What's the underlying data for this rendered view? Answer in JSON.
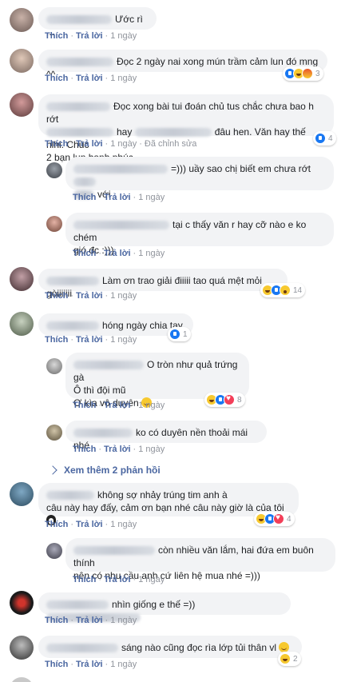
{
  "meta": {
    "like": "Thích",
    "reply": "Trả lời",
    "time": "1 ngày",
    "edited": "Đã chỉnh sửa",
    "dot": "·"
  },
  "comments": [
    {
      "text": "Ước rì ..."
    },
    {
      "text": "Đọc 2 ngày nai xong mún trầm cảm lun đó mng ^^",
      "count": "3"
    },
    {
      "line1": "Đọc xong bài tui đoán chủ tus chắc chưa bao h rớt",
      "line2a": "hay",
      "line2b": "đâu hen. Văn hay thế hihi. Chúc",
      "line3": "2 bạn lun hạnh phúc",
      "count": "4"
    },
    {
      "line1": "=))) uầy sao chị biết em chưa rớt",
      "line2": "với"
    },
    {
      "line1": "tại c thấy văn r hay cỡ nào e ko chém",
      "line2": "gió đc :)))"
    },
    {
      "text": "Làm ơn trao giải điiiii tao quá mệt mỏi gòiiiiiii",
      "count": "14"
    },
    {
      "text": "hóng ngày chia tay",
      "count": "1"
    },
    {
      "line1": "O tròn như quả trứng gà",
      "line2": "Ô thì đội mũ",
      "line3": "Ơ kìa vô duyên",
      "count": "8"
    },
    {
      "text": "ko có duyên nền thoải mái nhé"
    },
    {
      "line1": "không sợ nhảy trúng tim anh à",
      "line2": "câu này hay đấy, cảm ơn bạn nhé câu này giờ là của tôi",
      "count": "4"
    },
    {
      "line1": "còn nhiều văn lắm, hai đứa em buôn thính",
      "line2": "nên có nhu cầu anh cứ liên hệ mua nhé =)))"
    },
    {
      "text": "nhìn giống e thế =))"
    },
    {
      "text": "sáng nào cũng đọc rìa lớp tủi thân vl",
      "count": "2"
    }
  ],
  "more_replies": "Xem thêm 2 phản hồi",
  "colors": {
    "bubble": "#f2f3f5",
    "link": "#4b67a1",
    "meta": "#90949c",
    "like": "#1877f2"
  }
}
